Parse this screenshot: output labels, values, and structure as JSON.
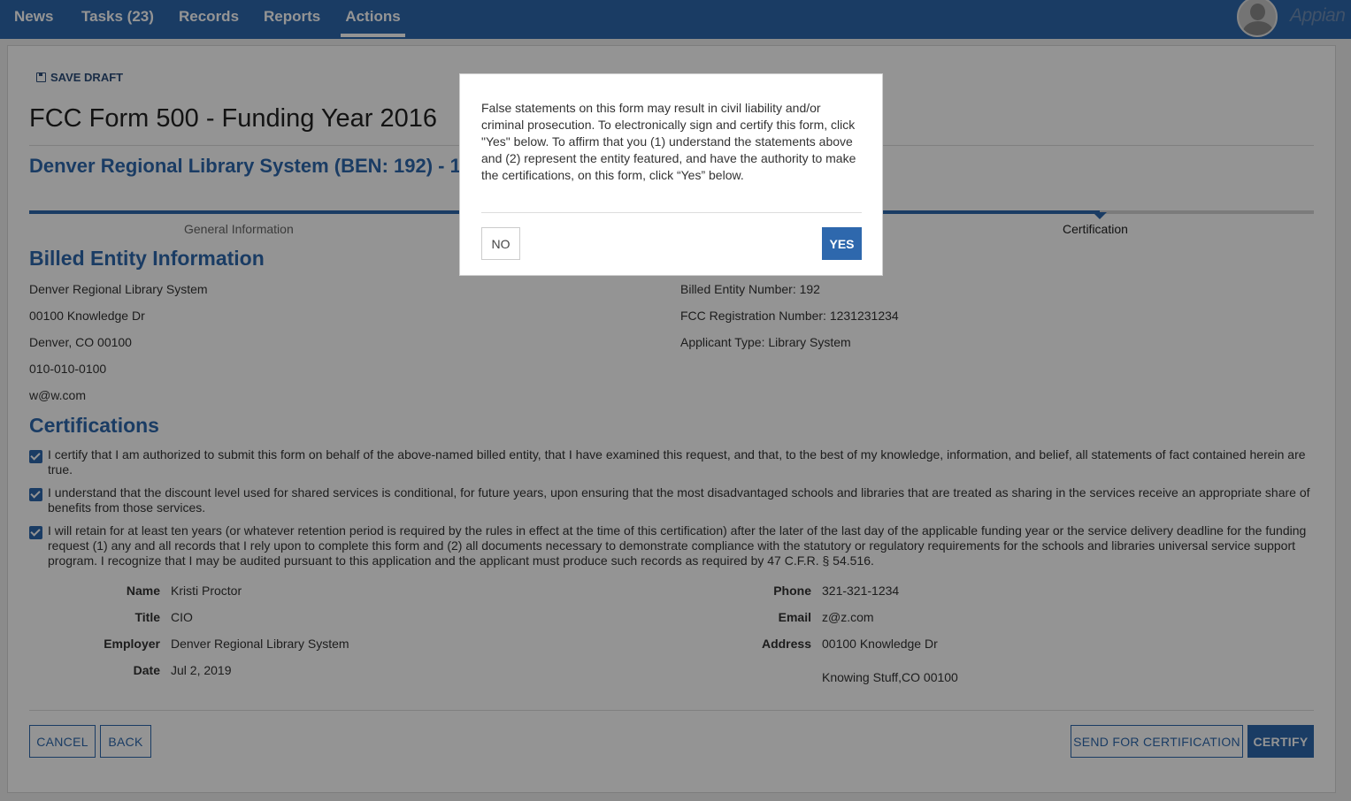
{
  "nav": {
    "items": [
      {
        "label": "News"
      },
      {
        "label": "Tasks (23)"
      },
      {
        "label": "Records"
      },
      {
        "label": "Reports"
      },
      {
        "label": "Actions",
        "active": true
      }
    ],
    "brand": "Appian"
  },
  "toolbar": {
    "save_draft": "SAVE DRAFT"
  },
  "page": {
    "title": "FCC Form 500 - Funding Year 2016",
    "subtitle": "Denver Regional Library System (BEN: 192) - 1"
  },
  "steps": [
    "General Information",
    "Certification"
  ],
  "billed": {
    "heading": "Billed Entity Information",
    "left": [
      "Denver Regional Library System",
      "00100 Knowledge Dr",
      "Denver, CO 00100",
      "010-010-0100",
      "w@w.com"
    ],
    "right": [
      "Billed Entity Number: 192",
      "FCC Registration Number: 1231231234",
      "Applicant Type: Library System"
    ]
  },
  "certifications": {
    "heading": "Certifications",
    "items": [
      "I certify that I am authorized to submit this form on behalf of the above-named billed entity, that I have examined this request, and that, to the best of my knowledge, information, and belief, all statements of fact contained herein are true.",
      "I understand that the discount level used for shared services is conditional, for future years, upon ensuring that the most disadvantaged schools and libraries that are treated as sharing in the services receive an appropriate share of benefits from those services.",
      "I will retain for at least ten years (or whatever retention period is required by the rules in effect at the time of this certification) after the later of the last day of the applicable funding year or the service delivery deadline for the funding request (1) any and all records that I rely upon to complete this form and (2) all documents necessary to demonstrate compliance with the statutory or regulatory requirements for the schools and libraries universal service support program. I recognize that I may be audited pursuant to this application and the applicant must produce such records as required by 47 C.F.R. § 54.516."
    ]
  },
  "signer": {
    "name_label": "Name",
    "name": "Kristi Proctor",
    "title_label": "Title",
    "title": "CIO",
    "employer_label": "Employer",
    "employer": "Denver Regional Library System",
    "date_label": "Date",
    "date": "Jul 2, 2019",
    "phone_label": "Phone",
    "phone": "321-321-1234",
    "email_label": "Email",
    "email": "z@z.com",
    "address_label": "Address",
    "address1": "00100 Knowledge Dr",
    "address2": "Knowing Stuff,CO 00100"
  },
  "footer": {
    "cancel": "CANCEL",
    "back": "BACK",
    "send": "SEND FOR CERTIFICATION",
    "certify": "CERTIFY"
  },
  "modal": {
    "text": "False statements on this form may result in civil liability and/or criminal prosecution. To electronically sign and certify this form, click \"Yes\" below. To affirm that you (1) understand the statements above and (2) represent the entity featured, and have the authority to make the certifications, on this form, click “Yes” below.",
    "no": "NO",
    "yes": "YES"
  },
  "colors": {
    "accent": "#2e68ad",
    "overlay": "rgba(0,0,0,0.42)"
  }
}
